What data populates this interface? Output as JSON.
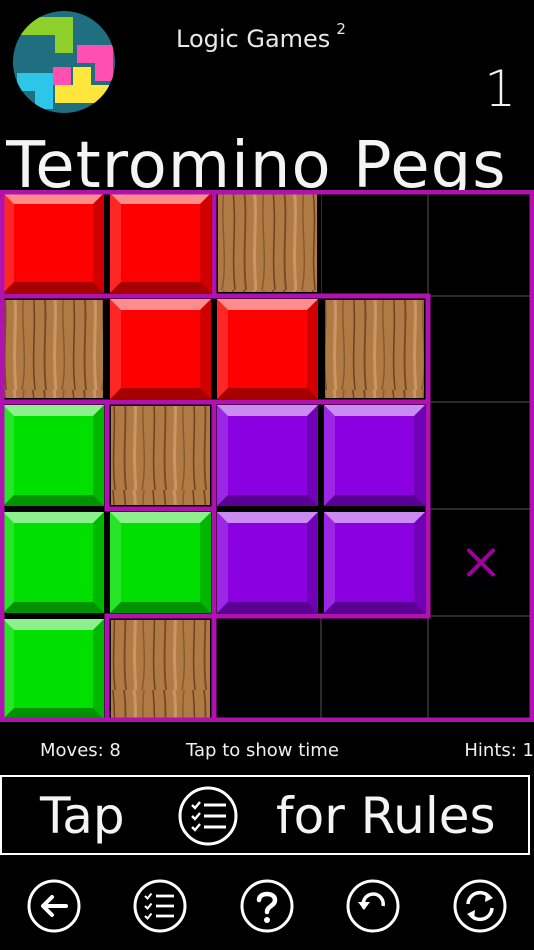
{
  "header": {
    "app_name": "Logic Games",
    "app_superscript": "2",
    "level": "1",
    "title": "Tetromino Pegs"
  },
  "board": {
    "rows": 5,
    "cols": 5,
    "cells": [
      [
        "red",
        "red",
        "wood",
        "empty",
        "empty"
      ],
      [
        "wood",
        "red",
        "red",
        "wood",
        "empty"
      ],
      [
        "green",
        "wood",
        "purple",
        "purple",
        "empty"
      ],
      [
        "green",
        "green",
        "purple",
        "purple",
        "x"
      ],
      [
        "green",
        "wood",
        "empty",
        "empty",
        "empty"
      ]
    ],
    "colors": {
      "red": "#ff0000",
      "green": "#00e000",
      "purple": "#8a00e0",
      "outline": "#b012b0",
      "x_mark": "#a000a0"
    }
  },
  "status": {
    "moves": "Moves: 8",
    "timer": "Tap to show time",
    "hints": "Hints: 1"
  },
  "rules": {
    "left": "Tap",
    "right": "for Rules"
  },
  "nav": [
    {
      "name": "back-icon"
    },
    {
      "name": "list-icon"
    },
    {
      "name": "help-icon"
    },
    {
      "name": "undo-icon"
    },
    {
      "name": "refresh-icon"
    }
  ]
}
